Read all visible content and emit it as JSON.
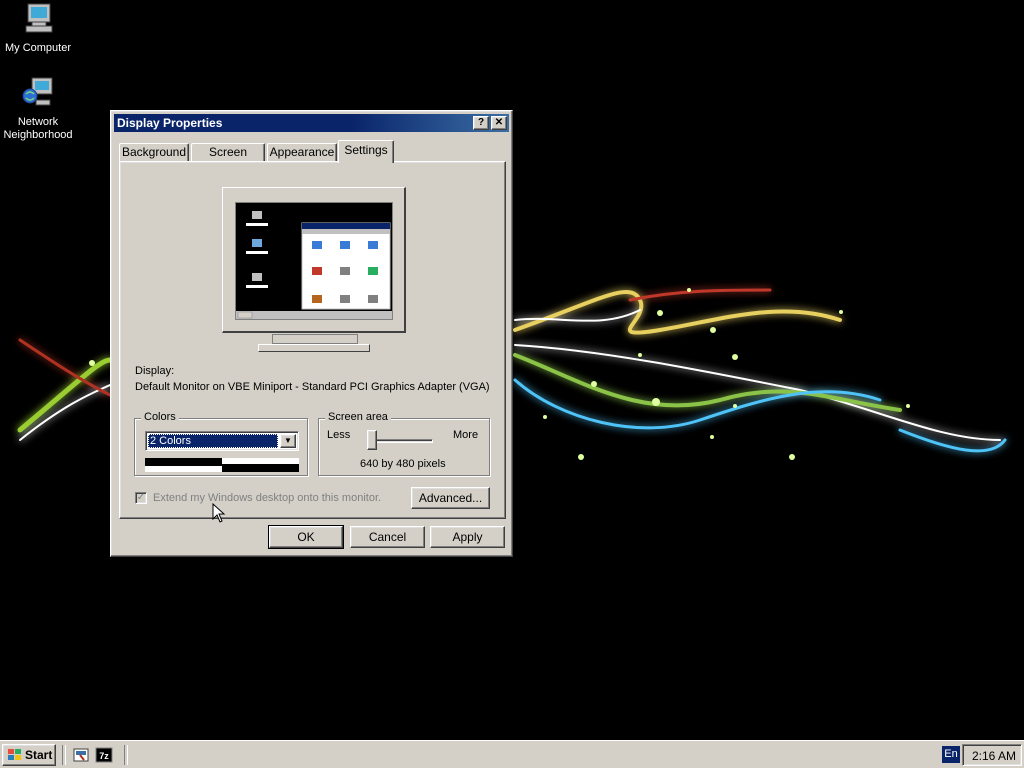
{
  "desktop": {
    "icons": [
      {
        "label": "My Computer"
      },
      {
        "label_line1": "Network",
        "label_line2": "Neighborhood"
      }
    ]
  },
  "window": {
    "title": "Display Properties",
    "help_button": "?",
    "close_button": "✕",
    "tabs": [
      {
        "label": "Background"
      },
      {
        "label": "Screen Saver"
      },
      {
        "label": "Appearance"
      },
      {
        "label": "Settings",
        "active": true
      }
    ],
    "display_label": "Display:",
    "display_value": "Default Monitor on VBE Miniport - Standard PCI Graphics Adapter (VGA)",
    "colors": {
      "legend": "Colors",
      "selected": "2 Colors"
    },
    "screen_area": {
      "legend": "Screen area",
      "less_label": "Less",
      "more_label": "More",
      "resolution": "640 by 480 pixels",
      "slider_level": 0
    },
    "extend_checkbox": {
      "label": "Extend my Windows desktop onto this monitor.",
      "checked": true,
      "disabled": true
    },
    "advanced_button": "Advanced...",
    "ok_button": "OK",
    "cancel_button": "Cancel",
    "apply_button": "Apply"
  },
  "taskbar": {
    "start_label": "Start",
    "language": "En",
    "clock": "2:16 AM"
  },
  "colors": {
    "title_bar": "#0a246a",
    "face": "#d4d0c8",
    "desktop": "#000000"
  }
}
